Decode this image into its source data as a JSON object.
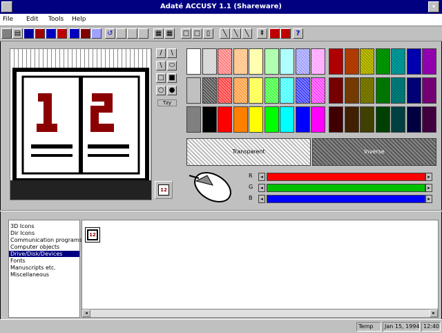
{
  "window": {
    "title": "Adaté ACCUSY 1.1 (Shareware)",
    "close_glyph": "▬",
    "restore_glyph": "◆"
  },
  "menu": {
    "items": [
      "File",
      "Edit",
      "Tools",
      "Help"
    ]
  },
  "toolbar": {
    "icons": [
      "save-icon",
      "save-all-icon",
      "copy-icon",
      "paste-icon",
      "image-icon",
      "check-icon",
      "cross-icon",
      "check-alt-icon",
      "undo-icon",
      "clear-icon",
      "fill-icon",
      "redo-icon",
      "grid-icon",
      "grid-alt-icon",
      "box-icon",
      "box2-icon",
      "box3-icon",
      "line-diag-icon",
      "line-diag2-icon",
      "line-diag3-icon",
      "pin-icon",
      "red-save-icon",
      "red-save2-icon",
      "help-icon"
    ],
    "help_glyph": "?"
  },
  "tools": {
    "labels": [
      "/",
      "\\",
      "⬭",
      "□",
      "■",
      "○",
      "●"
    ],
    "bottom_label": "Tzy"
  },
  "palette": {
    "colors_row1": [
      "#ffffff",
      "#d0d0d0",
      "#ff7f7f",
      "#ffbf7f",
      "#ffff9f",
      "#9fff9f",
      "#9fffff",
      "#9f9fff",
      "#ff9fff",
      "#c00000",
      "#c04000",
      "#c0c000",
      "#00a000",
      "#00a0a0",
      "#0000c0",
      "#a000c0"
    ],
    "colors_row2": [
      "#c0c0c0",
      "#505050",
      "#ff4040",
      "#ff9f3f",
      "#ffff40",
      "#40ff40",
      "#40ffff",
      "#4040ff",
      "#ff40ff",
      "#800000",
      "#804000",
      "#808000",
      "#008000",
      "#008080",
      "#000080",
      "#800080"
    ],
    "colors_row3": [
      "#808080",
      "#000000",
      "#ff0000",
      "#ff8000",
      "#ffff00",
      "#00ff00",
      "#00ffff",
      "#0000ff",
      "#ff00ff",
      "#400000",
      "#402000",
      "#404000",
      "#004000",
      "#004040",
      "#000040",
      "#400040"
    ],
    "transparent_label": "Transparent",
    "inverse_label": "Inverse"
  },
  "rgb_sliders": [
    {
      "label": "R",
      "color": "#ff0000"
    },
    {
      "label": "G",
      "color": "#00c000"
    },
    {
      "label": "B",
      "color": "#0000ff"
    }
  ],
  "preview": {
    "digits": "12"
  },
  "category_list": {
    "items": [
      "3D Icons",
      "Dir Icons",
      "Communication programs",
      "Computer objects",
      "Drive/Disk/Devices",
      "Fonts",
      "Manuscripts etc.",
      "Miscellaneous"
    ],
    "selected_index": 4
  },
  "statusbar": {
    "cells": [
      "Temp",
      "Jan 15, 1994",
      "12:40"
    ]
  }
}
